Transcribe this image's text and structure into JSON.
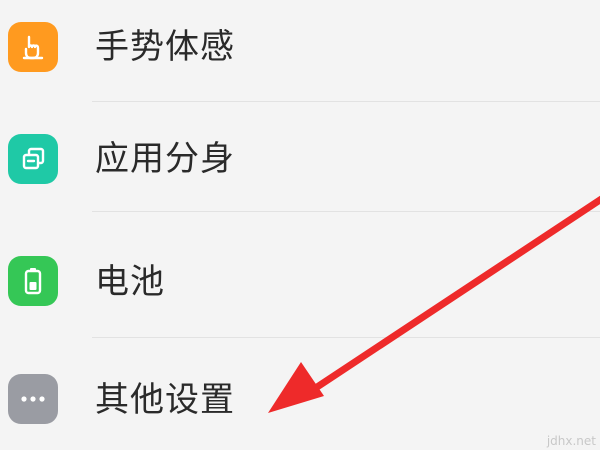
{
  "settings": {
    "items": [
      {
        "label": "手势体感",
        "icon": "gesture-hand-icon",
        "color": "#ff9a1f"
      },
      {
        "label": "应用分身",
        "icon": "app-clone-icon",
        "color": "#1fc9a6"
      },
      {
        "label": "电池",
        "icon": "battery-icon",
        "color": "#35c756"
      },
      {
        "label": "其他设置",
        "icon": "more-dots-icon",
        "color": "#9a9ca3"
      }
    ]
  },
  "annotation": {
    "arrow_color": "#ee2a2a",
    "points_to": "其他设置"
  },
  "watermark": "jdhx.net"
}
